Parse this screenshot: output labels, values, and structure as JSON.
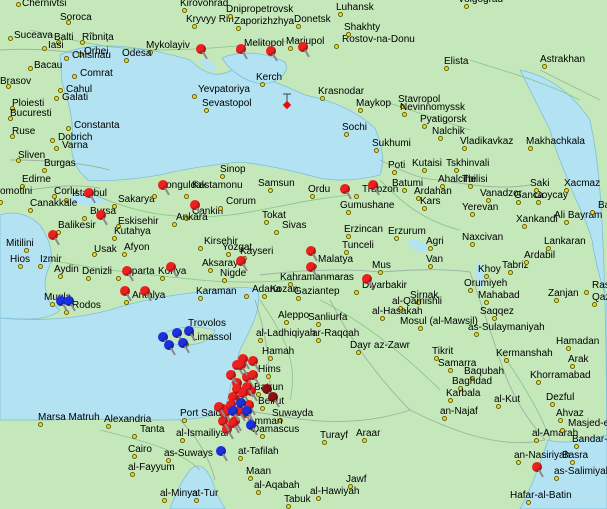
{
  "map": {
    "colors": {
      "land": "#c4e8ba",
      "water": "#b3e2f2",
      "border": "#9bb4a0",
      "road": "#8ac28a",
      "city": "#f2e020",
      "pin_red": "#ee1f1f",
      "pin_blue": "#1b30e0",
      "pin_darkred": "#8e0f0f"
    },
    "cities": [
      {
        "name": "Chernivtsi"
      },
      {
        "name": "Soroca"
      },
      {
        "name": "Suceava"
      },
      {
        "name": "Balti"
      },
      {
        "name": "Rîbnița"
      },
      {
        "name": "Iasi"
      },
      {
        "name": "Orhei"
      },
      {
        "name": "Chisinau"
      },
      {
        "name": "Bacau"
      },
      {
        "name": "Comrat"
      },
      {
        "name": "Cahul"
      },
      {
        "name": "Galati"
      },
      {
        "name": "Brasov"
      },
      {
        "name": "Ploiesti"
      },
      {
        "name": "Bucuresti"
      },
      {
        "name": "Ruse"
      },
      {
        "name": "Constanta"
      },
      {
        "name": "Dobrich"
      },
      {
        "name": "Varna"
      },
      {
        "name": "Sliven"
      },
      {
        "name": "Burgas"
      },
      {
        "name": "Edirne"
      },
      {
        "name": "omotini"
      },
      {
        "name": "Corlu"
      },
      {
        "name": "Istanbul"
      },
      {
        "name": "Sakarya"
      },
      {
        "name": "Canakkale"
      },
      {
        "name": "Bursa"
      },
      {
        "name": "Balikesir"
      },
      {
        "name": "Eskisehir"
      },
      {
        "name": "Kutahya"
      },
      {
        "name": "Mitilini"
      },
      {
        "name": "Usak"
      },
      {
        "name": "Afyon"
      },
      {
        "name": "Hios"
      },
      {
        "name": "Izmir"
      },
      {
        "name": "Aydin"
      },
      {
        "name": "Denizli"
      },
      {
        "name": "Isparta"
      },
      {
        "name": "Konya"
      },
      {
        "name": "Mugla"
      },
      {
        "name": "Antalya"
      },
      {
        "name": "Rodos"
      },
      {
        "name": "Zonguldak"
      },
      {
        "name": "Kastamonu"
      },
      {
        "name": "Sinop"
      },
      {
        "name": "Samsun"
      },
      {
        "name": "Ordu"
      },
      {
        "name": "Trabzon"
      },
      {
        "name": "Cankiri"
      },
      {
        "name": "Corum"
      },
      {
        "name": "Ankara"
      },
      {
        "name": "Tokat"
      },
      {
        "name": "Yozgat"
      },
      {
        "name": "Sivas"
      },
      {
        "name": "Kirsehir"
      },
      {
        "name": "Kayseri"
      },
      {
        "name": "Aksaray"
      },
      {
        "name": "Nigde"
      },
      {
        "name": "Karaman"
      },
      {
        "name": "Adana"
      },
      {
        "name": "Malatya"
      },
      {
        "name": "Kahramanmaras"
      },
      {
        "name": "Gaziantep"
      },
      {
        "name": "Aleppo"
      },
      {
        "name": "Sanliurfa"
      },
      {
        "name": "Diyarbakir"
      },
      {
        "name": "Erzincan"
      },
      {
        "name": "Tunceli"
      },
      {
        "name": "Erzurum"
      },
      {
        "name": "Gumushane"
      },
      {
        "name": "Agri"
      },
      {
        "name": "Mus"
      },
      {
        "name": "Van"
      },
      {
        "name": "Sirnak"
      },
      {
        "name": "al-Qamishli"
      },
      {
        "name": "al-Hasakah"
      },
      {
        "name": "Mosul (al-Mawsil)"
      },
      {
        "name": "ar-Raqqah"
      },
      {
        "name": "Dayr az-Zawr"
      },
      {
        "name": "al-Ladhiqiyah"
      },
      {
        "name": "Hamah"
      },
      {
        "name": "Hims"
      },
      {
        "name": "Batrun"
      },
      {
        "name": "Beirut"
      },
      {
        "name": "Damascus"
      },
      {
        "name": "Suwayda"
      },
      {
        "name": "Amman"
      },
      {
        "name": "at-Tafilah"
      },
      {
        "name": "Maan"
      },
      {
        "name": "al-Aqabah"
      },
      {
        "name": "Tabuk"
      },
      {
        "name": "al-Hawiyah"
      },
      {
        "name": "Jawf"
      },
      {
        "name": "Turayf"
      },
      {
        "name": "Araar"
      },
      {
        "name": "Hafar-al-Batin"
      },
      {
        "name": "as-Salimiyah"
      },
      {
        "name": "Basra"
      },
      {
        "name": "Bandar-e"
      },
      {
        "name": "an-Nasiriyah"
      },
      {
        "name": "al-Amarah"
      },
      {
        "name": "Masjed-e"
      },
      {
        "name": "Ahvaz"
      },
      {
        "name": "Dezful"
      },
      {
        "name": "Khorramabad"
      },
      {
        "name": "Arak"
      },
      {
        "name": "Hamadan"
      },
      {
        "name": "Kermanshah"
      },
      {
        "name": "Baqubah"
      },
      {
        "name": "Baghdad"
      },
      {
        "name": "Samarra"
      },
      {
        "name": "Tikrit"
      },
      {
        "name": "Karbala"
      },
      {
        "name": "an-Najaf"
      },
      {
        "name": "al-Kut"
      },
      {
        "name": "as-Sulaymaniyah"
      },
      {
        "name": "Saqqez"
      },
      {
        "name": "Mahabad"
      },
      {
        "name": "Orumiyeh"
      },
      {
        "name": "Khoy"
      },
      {
        "name": "Tabriz"
      },
      {
        "name": "Ardabil"
      },
      {
        "name": "Lankaran"
      },
      {
        "name": "Zanjan"
      },
      {
        "name": "Qazvin"
      },
      {
        "name": "Rasht"
      },
      {
        "name": "Naxcivan"
      },
      {
        "name": "Xankandi"
      },
      {
        "name": "Yerevan"
      },
      {
        "name": "Vanadzor"
      },
      {
        "name": "Ganca"
      },
      {
        "name": "Goycay"
      },
      {
        "name": "Ali Bayram"
      },
      {
        "name": "Baku"
      },
      {
        "name": "Xacmaz"
      },
      {
        "name": "Saki"
      },
      {
        "name": "Tbilisi"
      },
      {
        "name": "Ahalcihe"
      },
      {
        "name": "Ardahan"
      },
      {
        "name": "Kars"
      },
      {
        "name": "Batumi"
      },
      {
        "name": "Kutaisi"
      },
      {
        "name": "Tskhinvali"
      },
      {
        "name": "Poti"
      },
      {
        "name": "Sukhumi"
      },
      {
        "name": "Sochi"
      },
      {
        "name": "Vladikavkaz"
      },
      {
        "name": "Nalchik"
      },
      {
        "name": "Makhachkala"
      },
      {
        "name": "Pyatigorsk"
      },
      {
        "name": "Stavropol"
      },
      {
        "name": "Nevinnomyssk"
      },
      {
        "name": "Maykop"
      },
      {
        "name": "Krasnodar"
      },
      {
        "name": "Kerch"
      },
      {
        "name": "Yevpatoriya"
      },
      {
        "name": "Sevastopol"
      },
      {
        "name": "Mykolayiv"
      },
      {
        "name": "Odesa"
      },
      {
        "name": "Melitopol"
      },
      {
        "name": "Mariupol"
      },
      {
        "name": "Rostov-na-Donu"
      },
      {
        "name": "Shakhty"
      },
      {
        "name": "Donetsk"
      },
      {
        "name": "Kryvyy Rih"
      },
      {
        "name": "Zaporizhzhya"
      },
      {
        "name": "Dnipropetrovsk"
      },
      {
        "name": "Kirovohrad"
      },
      {
        "name": "Luhansk"
      },
      {
        "name": "Volgograd"
      },
      {
        "name": "Elista"
      },
      {
        "name": "Astrakhan"
      },
      {
        "name": "Kozan"
      },
      {
        "name": "Trovolos"
      },
      {
        "name": "Limassol"
      },
      {
        "name": "Marsa Matruh"
      },
      {
        "name": "Alexandria"
      },
      {
        "name": "Tanta"
      },
      {
        "name": "Port Said"
      },
      {
        "name": "al-Ismailiyah"
      },
      {
        "name": "as-Suways"
      },
      {
        "name": "Cairo"
      },
      {
        "name": "al-Fayyum"
      },
      {
        "name": "al-Minya"
      },
      {
        "name": "at-Tur"
      }
    ],
    "pin_groups": {
      "red": 46,
      "blue": 12,
      "darkred": 2
    }
  }
}
